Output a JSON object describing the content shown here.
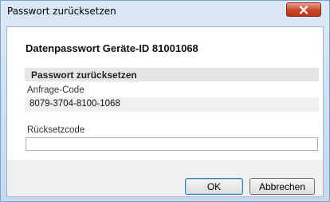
{
  "window": {
    "title": "Passwort zurücksetzen",
    "close_icon": "close-icon"
  },
  "dialog": {
    "heading": "Datenpasswort Geräte-ID 81001068",
    "section_title": "Passwort zurücksetzen",
    "request_code": {
      "label": "Anfrage-Code",
      "value": "8079-3704-8100-1068"
    },
    "reset_code": {
      "label": "Rücksetzcode",
      "value": "",
      "placeholder": ""
    }
  },
  "buttons": {
    "ok_label": "OK",
    "cancel_label": "Abbrechen"
  },
  "colors": {
    "title_bar": "#c6d9ef",
    "close_button": "#c8462c",
    "client_background": "#f0f0f0",
    "section_bar": "#e6e6e6"
  }
}
